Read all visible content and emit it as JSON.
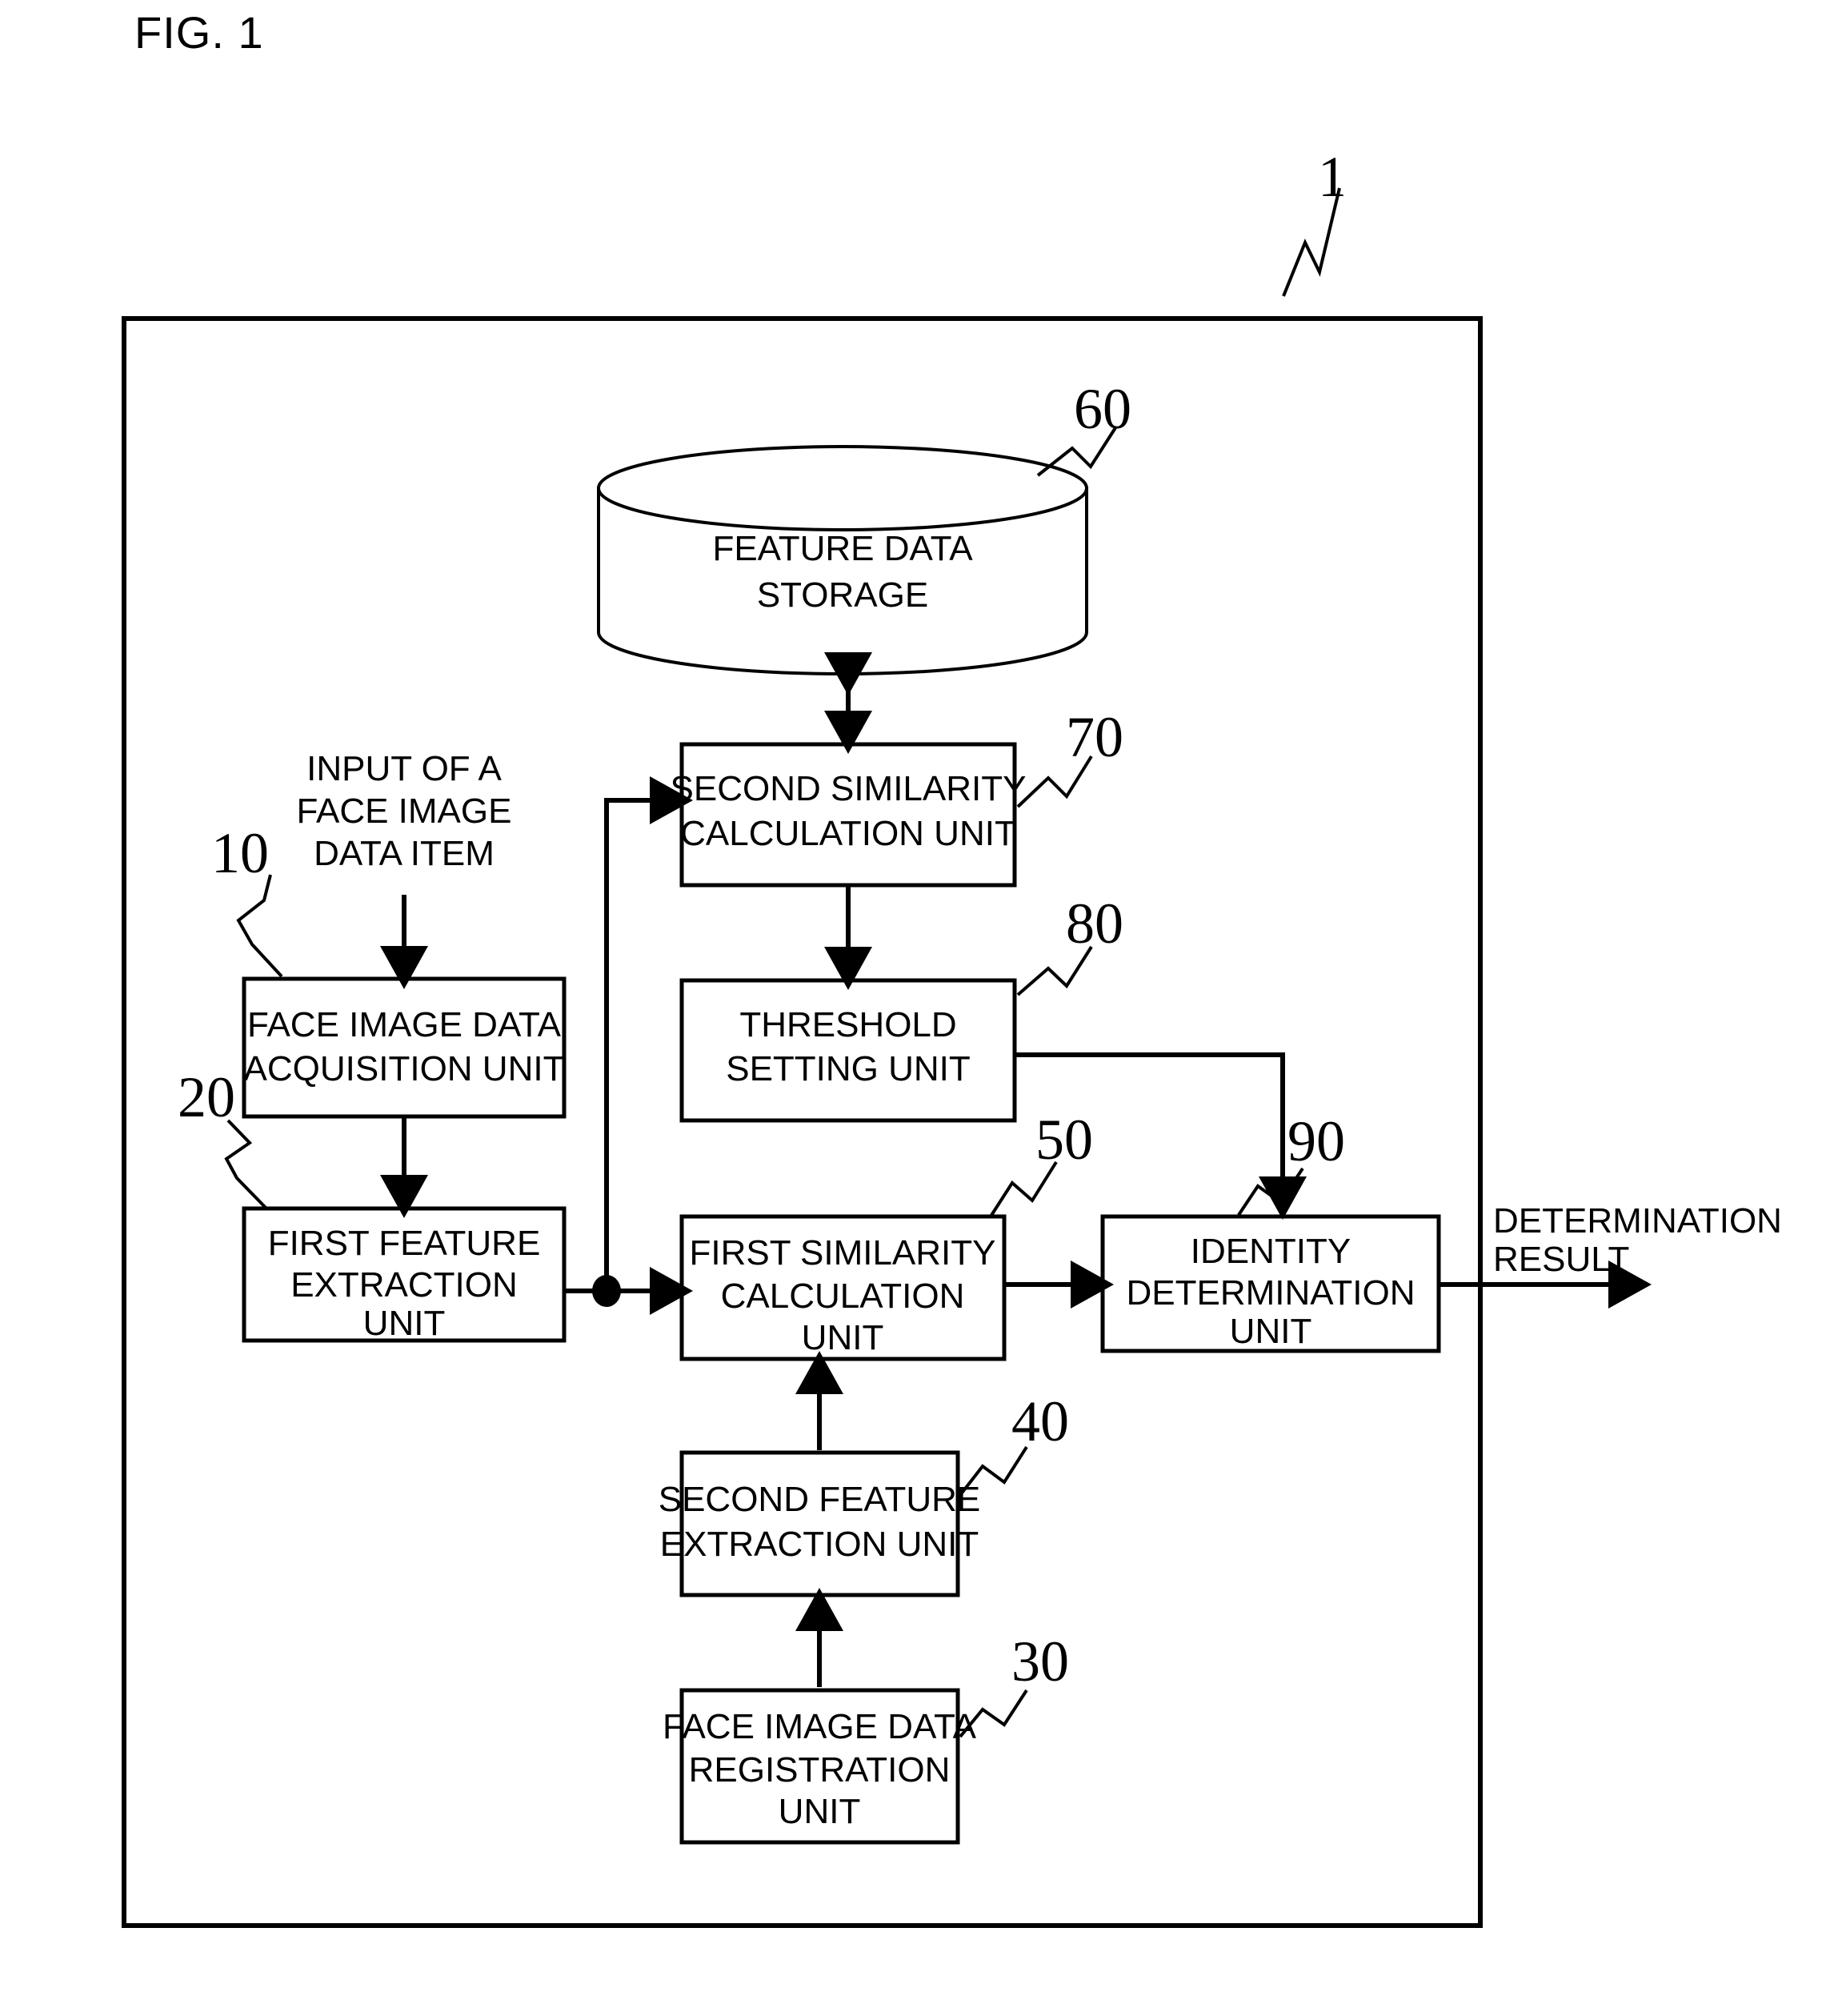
{
  "figure": {
    "caption": "FIG. 1",
    "system_ref": "1"
  },
  "blocks": [
    {
      "id": "feature-data-storage",
      "ref": "60",
      "shape": "cylinder",
      "lines": [
        "FEATURE DATA",
        "STORAGE"
      ]
    },
    {
      "id": "second-similarity-calculation-unit",
      "ref": "70",
      "shape": "rect",
      "lines": [
        "SECOND SIMILARITY",
        "CALCULATION UNIT"
      ]
    },
    {
      "id": "face-image-data-acquisition-unit",
      "ref": "10",
      "shape": "rect",
      "lines": [
        "FACE IMAGE DATA",
        "ACQUISITION UNIT"
      ]
    },
    {
      "id": "threshold-setting-unit",
      "ref": "80",
      "shape": "rect",
      "lines": [
        "THRESHOLD",
        "SETTING UNIT"
      ]
    },
    {
      "id": "first-feature-extraction-unit",
      "ref": "20",
      "shape": "rect",
      "lines": [
        "FIRST FEATURE",
        "EXTRACTION",
        "UNIT"
      ]
    },
    {
      "id": "first-similarity-calculation-unit",
      "ref": "50",
      "shape": "rect",
      "lines": [
        "FIRST SIMILARITY",
        "CALCULATION",
        "UNIT"
      ]
    },
    {
      "id": "identity-determination-unit",
      "ref": "90",
      "shape": "rect",
      "lines": [
        "IDENTITY",
        "DETERMINATION",
        "UNIT"
      ]
    },
    {
      "id": "second-feature-extraction-unit",
      "ref": "40",
      "shape": "rect",
      "lines": [
        "SECOND FEATURE",
        "EXTRACTION UNIT"
      ]
    },
    {
      "id": "face-image-data-registration-unit",
      "ref": "30",
      "shape": "rect",
      "lines": [
        "FACE IMAGE DATA",
        "REGISTRATION",
        "UNIT"
      ]
    }
  ],
  "annotations": {
    "input_label": [
      "INPUT OF A",
      "FACE IMAGE",
      "DATA ITEM"
    ],
    "output_label": [
      "DETERMINATION",
      "RESULT"
    ]
  },
  "colors": {
    "stroke": "#000000",
    "background": "#ffffff"
  }
}
